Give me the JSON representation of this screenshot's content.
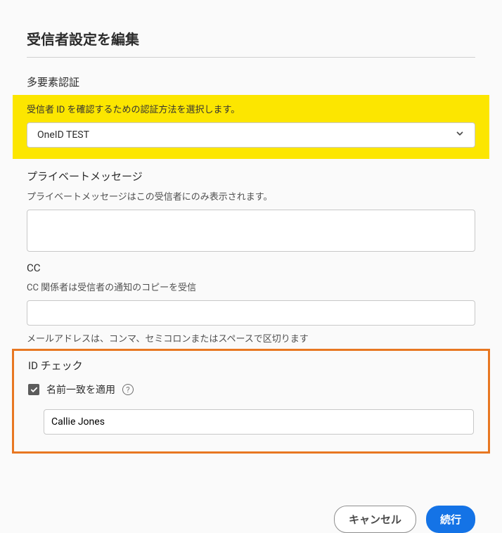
{
  "page": {
    "title": "受信者設定を編集"
  },
  "mfa": {
    "label": "多要素認証",
    "help": "受信者 ID を確認するための認証方法を選択します。",
    "selected": "OneID TEST"
  },
  "private_message": {
    "label": "プライベートメッセージ",
    "help": "プライベートメッセージはこの受信者にのみ表示されます。",
    "value": ""
  },
  "cc": {
    "label": "CC",
    "help": "CC 関係者は受信者の通知のコピーを受信",
    "value": "",
    "sub_help": "メールアドレスは、コンマ、セミコロンまたはスペースで区切ります"
  },
  "id_check": {
    "label": "ID チェック",
    "checkbox_label": "名前一致を適用",
    "value": "Callie Jones"
  },
  "buttons": {
    "cancel": "キャンセル",
    "continue": "続行"
  }
}
